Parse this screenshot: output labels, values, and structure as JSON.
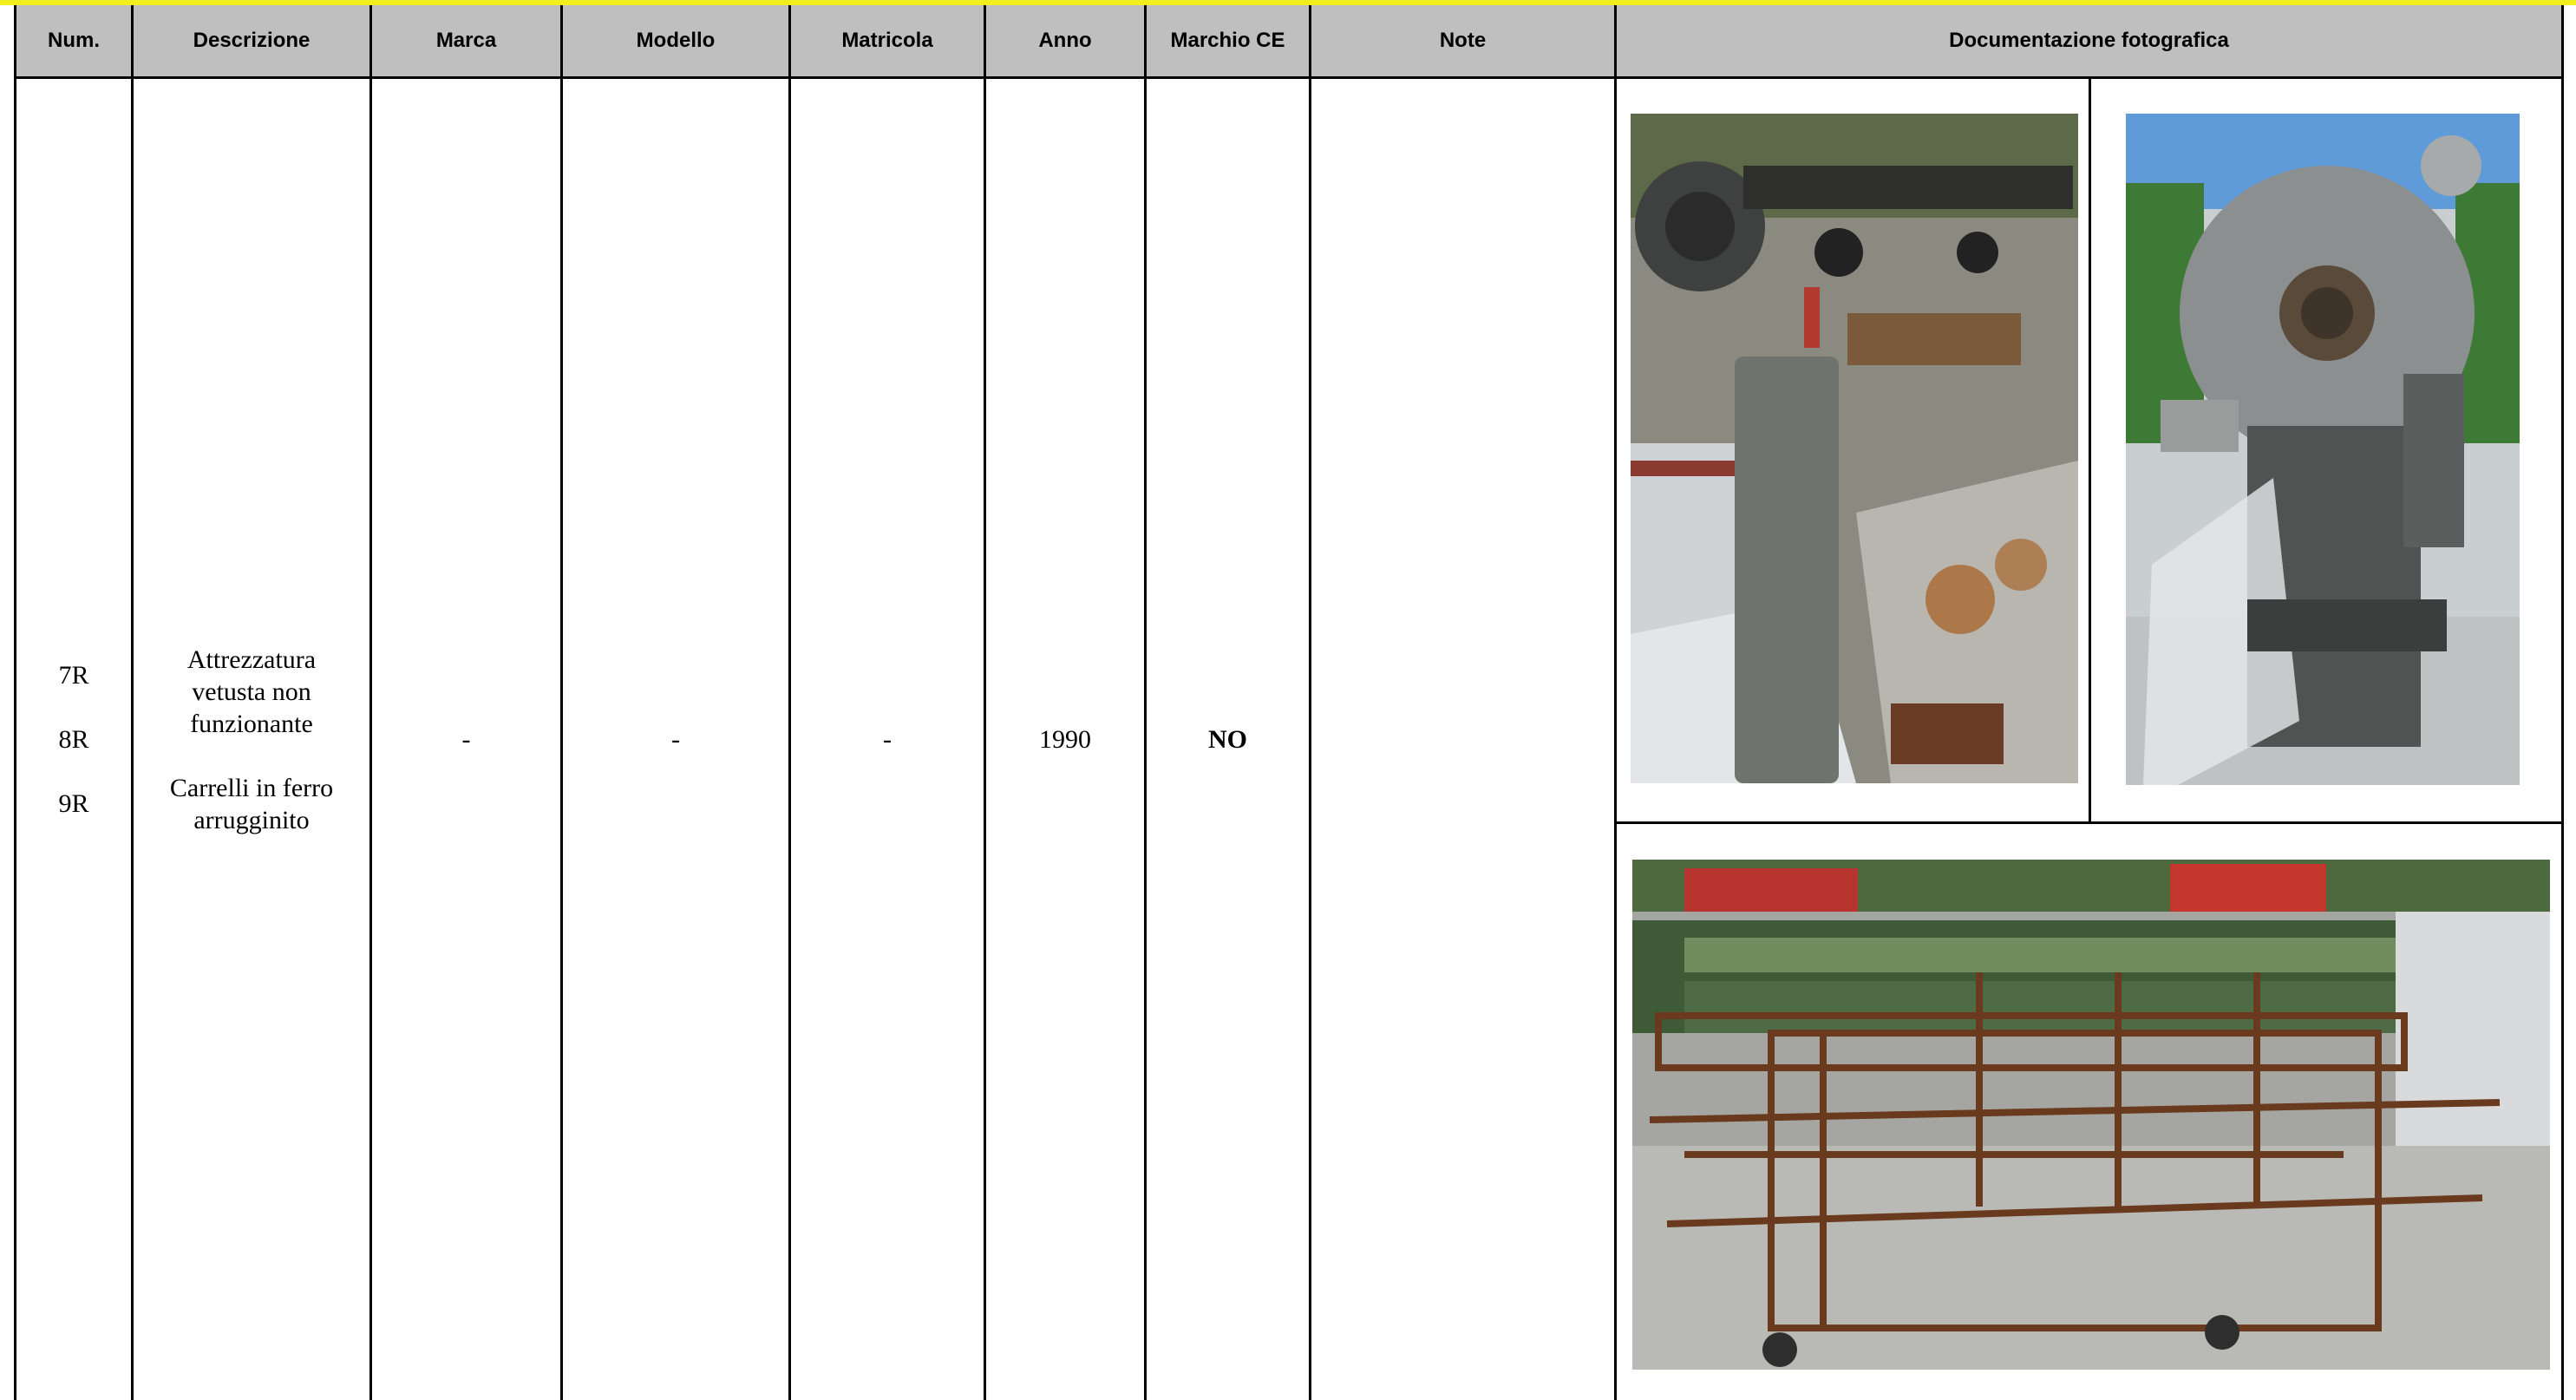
{
  "table": {
    "headers": [
      "Num.",
      "Descrizione",
      "Marca",
      "Modello",
      "Matricola",
      "Anno",
      "Marchio CE",
      "Note",
      "Documentazione fotografica"
    ],
    "row": {
      "num": [
        "7R",
        "8R",
        "9R"
      ],
      "descrizione_1": [
        "Attrezzatura",
        "vetusta non",
        "funzionante"
      ],
      "descrizione_2": [
        "Carrelli in ferro",
        "arrugginito"
      ],
      "marca": "-",
      "modello": "-",
      "matricola": "-",
      "anno": "1990",
      "marchio_ce": "NO",
      "note": ""
    }
  },
  "colors": {
    "header_bg": "#bfbfbf",
    "accent_bar": "#f2ef1f",
    "border": "#000000"
  }
}
